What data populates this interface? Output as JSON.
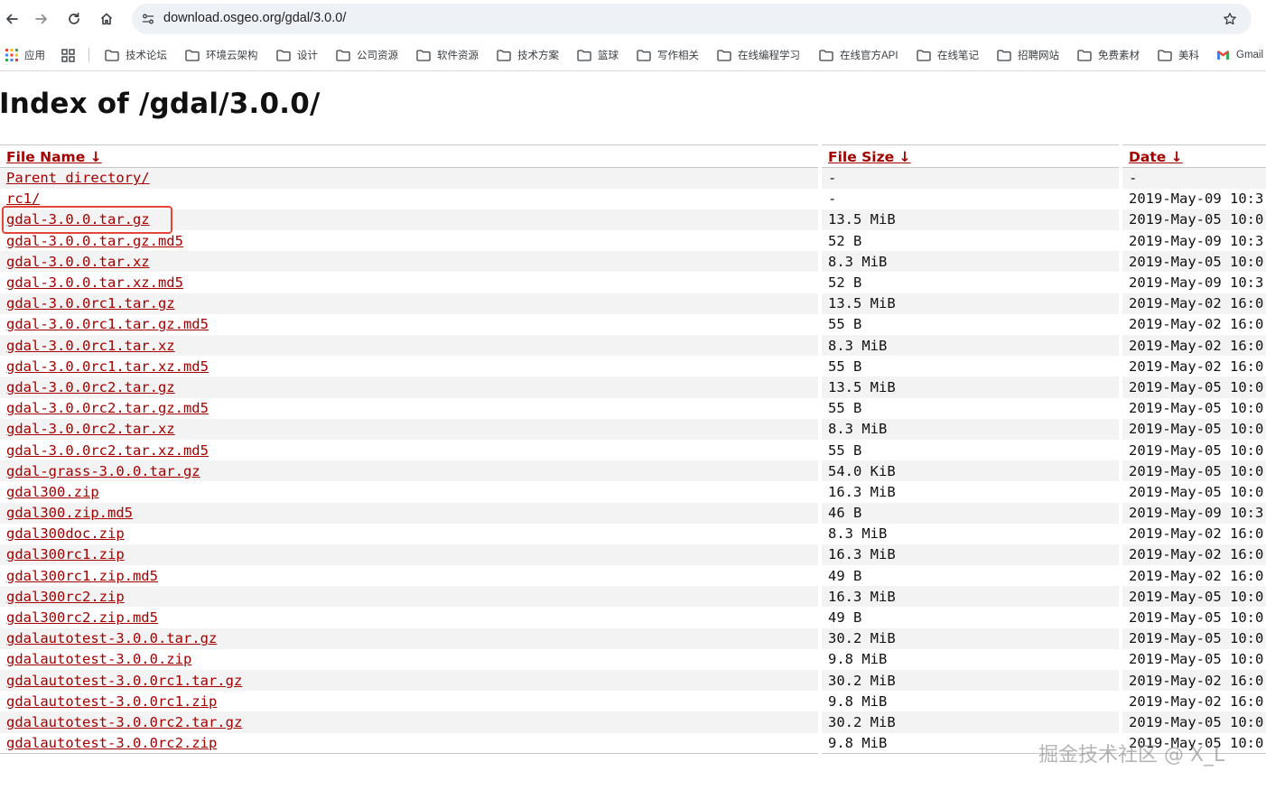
{
  "browser": {
    "url": "download.osgeo.org/gdal/3.0.0/",
    "bookmarks": [
      {
        "label": "应用",
        "icon": "apps-grid-icon"
      },
      {
        "label": "",
        "icon": "tab-groups-icon"
      },
      {
        "label": "技术论坛",
        "icon": "folder-icon"
      },
      {
        "label": "环境云架构",
        "icon": "folder-icon"
      },
      {
        "label": "设计",
        "icon": "folder-icon"
      },
      {
        "label": "公司资源",
        "icon": "folder-icon"
      },
      {
        "label": "软件资源",
        "icon": "folder-icon"
      },
      {
        "label": "技术方案",
        "icon": "folder-icon"
      },
      {
        "label": "篮球",
        "icon": "folder-icon"
      },
      {
        "label": "写作相关",
        "icon": "folder-icon"
      },
      {
        "label": "在线编程学习",
        "icon": "folder-icon"
      },
      {
        "label": "在线官方API",
        "icon": "folder-icon"
      },
      {
        "label": "在线笔记",
        "icon": "folder-icon"
      },
      {
        "label": "招聘网站",
        "icon": "folder-icon"
      },
      {
        "label": "免费素材",
        "icon": "folder-icon"
      },
      {
        "label": "美科",
        "icon": "folder-icon"
      },
      {
        "label": "Gmail",
        "icon": "gmail-icon"
      }
    ]
  },
  "page": {
    "heading": "Index of /gdal/3.0.0/",
    "columns": {
      "name": "File Name  ↓ ",
      "size": "File Size  ↓ ",
      "date": "Date  ↓ "
    },
    "rows": [
      {
        "name": "Parent directory/",
        "size": "-",
        "date": "-"
      },
      {
        "name": "rc1/",
        "size": "-",
        "date": "2019-May-09 10:3"
      },
      {
        "name": "gdal-3.0.0.tar.gz",
        "size": "13.5 MiB",
        "date": "2019-May-05 10:0"
      },
      {
        "name": "gdal-3.0.0.tar.gz.md5",
        "size": "52 B",
        "date": "2019-May-09 10:3"
      },
      {
        "name": "gdal-3.0.0.tar.xz",
        "size": "8.3 MiB",
        "date": "2019-May-05 10:0"
      },
      {
        "name": "gdal-3.0.0.tar.xz.md5",
        "size": "52 B",
        "date": "2019-May-09 10:3"
      },
      {
        "name": "gdal-3.0.0rc1.tar.gz",
        "size": "13.5 MiB",
        "date": "2019-May-02 16:0"
      },
      {
        "name": "gdal-3.0.0rc1.tar.gz.md5",
        "size": "55 B",
        "date": "2019-May-02 16:0"
      },
      {
        "name": "gdal-3.0.0rc1.tar.xz",
        "size": "8.3 MiB",
        "date": "2019-May-02 16:0"
      },
      {
        "name": "gdal-3.0.0rc1.tar.xz.md5",
        "size": "55 B",
        "date": "2019-May-02 16:0"
      },
      {
        "name": "gdal-3.0.0rc2.tar.gz",
        "size": "13.5 MiB",
        "date": "2019-May-05 10:0"
      },
      {
        "name": "gdal-3.0.0rc2.tar.gz.md5",
        "size": "55 B",
        "date": "2019-May-05 10:0"
      },
      {
        "name": "gdal-3.0.0rc2.tar.xz",
        "size": "8.3 MiB",
        "date": "2019-May-05 10:0"
      },
      {
        "name": "gdal-3.0.0rc2.tar.xz.md5",
        "size": "55 B",
        "date": "2019-May-05 10:0"
      },
      {
        "name": "gdal-grass-3.0.0.tar.gz",
        "size": "54.0 KiB",
        "date": "2019-May-05 10:0"
      },
      {
        "name": "gdal300.zip",
        "size": "16.3 MiB",
        "date": "2019-May-05 10:0"
      },
      {
        "name": "gdal300.zip.md5",
        "size": "46 B",
        "date": "2019-May-09 10:3"
      },
      {
        "name": "gdal300doc.zip",
        "size": "8.3 MiB",
        "date": "2019-May-02 16:0"
      },
      {
        "name": "gdal300rc1.zip",
        "size": "16.3 MiB",
        "date": "2019-May-02 16:0"
      },
      {
        "name": "gdal300rc1.zip.md5",
        "size": "49 B",
        "date": "2019-May-02 16:0"
      },
      {
        "name": "gdal300rc2.zip",
        "size": "16.3 MiB",
        "date": "2019-May-05 10:0"
      },
      {
        "name": "gdal300rc2.zip.md5",
        "size": "49 B",
        "date": "2019-May-05 10:0"
      },
      {
        "name": "gdalautotest-3.0.0.tar.gz",
        "size": "30.2 MiB",
        "date": "2019-May-05 10:0"
      },
      {
        "name": "gdalautotest-3.0.0.zip",
        "size": "9.8 MiB",
        "date": "2019-May-05 10:0"
      },
      {
        "name": "gdalautotest-3.0.0rc1.tar.gz",
        "size": "30.2 MiB",
        "date": "2019-May-02 16:0"
      },
      {
        "name": "gdalautotest-3.0.0rc1.zip",
        "size": "9.8 MiB",
        "date": "2019-May-02 16:0"
      },
      {
        "name": "gdalautotest-3.0.0rc2.tar.gz",
        "size": "30.2 MiB",
        "date": "2019-May-05 10:0"
      },
      {
        "name": "gdalautotest-3.0.0rc2.zip",
        "size": "9.8 MiB",
        "date": "2019-May-05 10:0"
      }
    ],
    "highlighted_row": "gdal-3.0.0.tar.gz"
  },
  "watermark": "掘金技术社区 @ X_L",
  "colors": {
    "link": "#a40000",
    "highlight": "#e4463a",
    "stripe": "#f3f3f3",
    "omnibox": "#eef1f6"
  }
}
